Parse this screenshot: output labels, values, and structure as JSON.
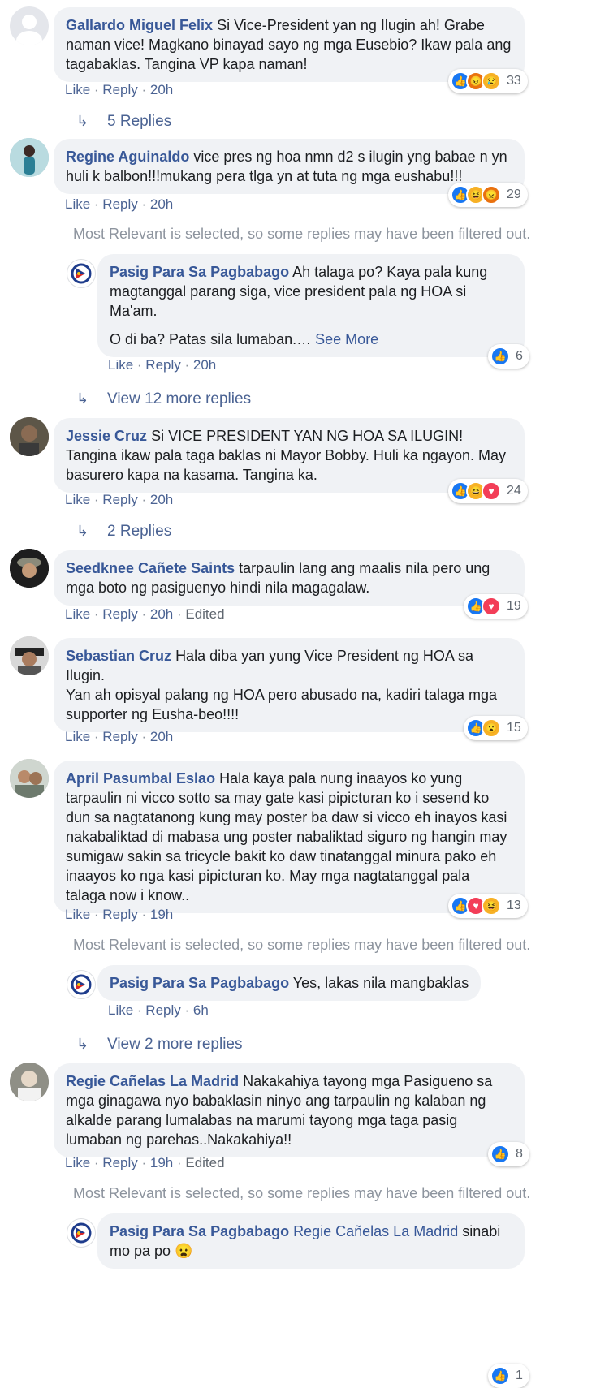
{
  "comments": [
    {
      "author": "Gallardo Miguel Felix",
      "text": "Si Vice-President yan ng Ilugin ah! Grabe naman vice! Magkano binayad sayo ng mga Eusebio? Ikaw pala ang tagabaklas. Tangina VP kapa naman!",
      "like": "Like",
      "reply": "Reply",
      "time": "20h",
      "reaction_count": "33",
      "reaction_icons": [
        "like-icon",
        "angry-icon",
        "sad-icon"
      ]
    },
    {
      "author": "Regine Aguinaldo",
      "text": "vice pres ng hoa nmn d2 s ilugin yng babae n yn huli k balbon!!!mukang pera tlga yn at tuta ng mga eushabu!!!",
      "like": "Like",
      "reply": "Reply",
      "time": "20h",
      "reaction_count": "29",
      "reaction_icons": [
        "like-icon",
        "haha-icon",
        "angry-icon"
      ]
    },
    {
      "author": "Jessie Cruz",
      "text": "Si VICE PRESIDENT YAN NG HOA SA ILUGIN! Tangina ikaw pala taga baklas ni Mayor Bobby. Huli ka ngayon. May basurero kapa na kasama. Tangina ka.",
      "like": "Like",
      "reply": "Reply",
      "time": "20h",
      "reaction_count": "24",
      "reaction_icons": [
        "like-icon",
        "haha-icon",
        "love-icon"
      ]
    },
    {
      "author": "Seedknee Cañete Saints",
      "text": "tarpaulin lang ang maalis nila pero ung mga boto ng pasiguenyo hindi nila magagalaw.",
      "like": "Like",
      "reply": "Reply",
      "time": "20h",
      "edited": "Edited",
      "reaction_count": "19",
      "reaction_icons": [
        "like-icon",
        "love-icon"
      ]
    },
    {
      "author": "Sebastian Cruz",
      "text_lines": [
        "Hala diba yan yung Vice President ng HOA sa Ilugin.",
        "Yan ah opisyal palang ng HOA pero abusado na, kadiri talaga mga supporter ng Eusha-beo!!!!"
      ],
      "like": "Like",
      "reply": "Reply",
      "time": "20h",
      "reaction_count": "15",
      "reaction_icons": [
        "like-icon",
        "wow-icon"
      ]
    },
    {
      "author": "April Pasumbal Eslao",
      "text": "Hala kaya pala nung inaayos ko yung tarpaulin ni vicco sotto sa may gate kasi pipicturan ko i sesend ko dun sa nagtatanong kung may poster ba daw si vicco eh inayos kasi nakabaliktad di mabasa ung poster nabaliktad siguro ng hangin may sumigaw sakin sa tricycle bakit ko daw tinatanggal minura pako eh inaayos ko nga kasi pipicturan ko. May mga nagtatanggal pala talaga now i know..",
      "like": "Like",
      "reply": "Reply",
      "time": "19h",
      "reaction_count": "13",
      "reaction_icons": [
        "like-icon",
        "love-icon",
        "haha-icon"
      ]
    },
    {
      "author": "Regie Cañelas La Madrid",
      "text": "Nakakahiya tayong mga Pasigueno sa mga ginagawa nyo babaklasin ninyo ang tarpaulin ng kalaban ng alkalde parang lumalabas na marumi tayong mga taga pasig lumaban ng parehas..Nakakahiya!!",
      "like": "Like",
      "reply": "Reply",
      "time": "19h",
      "edited": "Edited",
      "reaction_count": "8",
      "reaction_icons": [
        "like-icon"
      ]
    }
  ],
  "replies": [
    {
      "author": "Pasig Para Sa Pagbabago",
      "text": "Ah talaga po? Kaya pala kung magtanggal parang siga, vice president pala ng HOA si Ma'am.",
      "text2": "O di ba? Patas sila lumaban.…",
      "see_more": "See More",
      "like": "Like",
      "reply": "Reply",
      "time": "20h",
      "reaction_count": "6"
    },
    {
      "author": "Pasig Para Sa Pagbabago",
      "text": "Yes, lakas nila mangbaklas",
      "like": "Like",
      "reply": "Reply",
      "time": "6h"
    },
    {
      "author": "Pasig Para Sa Pagbabago",
      "mention": "Regie Cañelas La Madrid",
      "text": "sinabi mo pa po 😦",
      "reaction_count": "1"
    }
  ],
  "threads": {
    "r1": "5 Replies",
    "r2": "View 12 more replies",
    "r3": "2 Replies",
    "r4": "View 2 more replies"
  },
  "notice": "Most Relevant is selected, so some replies may have been filtered out.",
  "sep": " · "
}
